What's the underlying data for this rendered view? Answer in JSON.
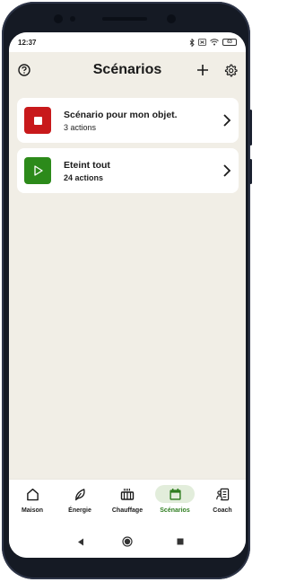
{
  "status_bar": {
    "time": "12:37",
    "battery": "63",
    "icons": [
      "bluetooth-icon",
      "vibrate-icon",
      "wifi-icon",
      "battery-icon"
    ]
  },
  "header": {
    "title": "Scénarios",
    "help_icon": "question-circle-icon",
    "add_icon": "plus-icon",
    "settings_icon": "gear-icon"
  },
  "scenarios": [
    {
      "title": "Scénario pour mon objet.",
      "subtitle": "3 actions",
      "icon": "stop-icon",
      "color": "#c8191b"
    },
    {
      "title": "Eteint tout",
      "subtitle": "24 actions",
      "icon": "play-icon",
      "color": "#2c8a1a"
    }
  ],
  "bottom_nav": {
    "items": [
      {
        "label": "Maison",
        "icon": "house-icon",
        "active": false
      },
      {
        "label": "Énergie",
        "icon": "leaf-icon",
        "active": false
      },
      {
        "label": "Chauffage",
        "icon": "radiator-icon",
        "active": false
      },
      {
        "label": "Scénarios",
        "icon": "calendar-icon",
        "active": true
      },
      {
        "label": "Coach",
        "icon": "coach-icon",
        "active": false
      }
    ],
    "active_color": "#2e7d1f"
  },
  "system_nav": [
    "back-icon",
    "home-icon",
    "recents-icon"
  ]
}
